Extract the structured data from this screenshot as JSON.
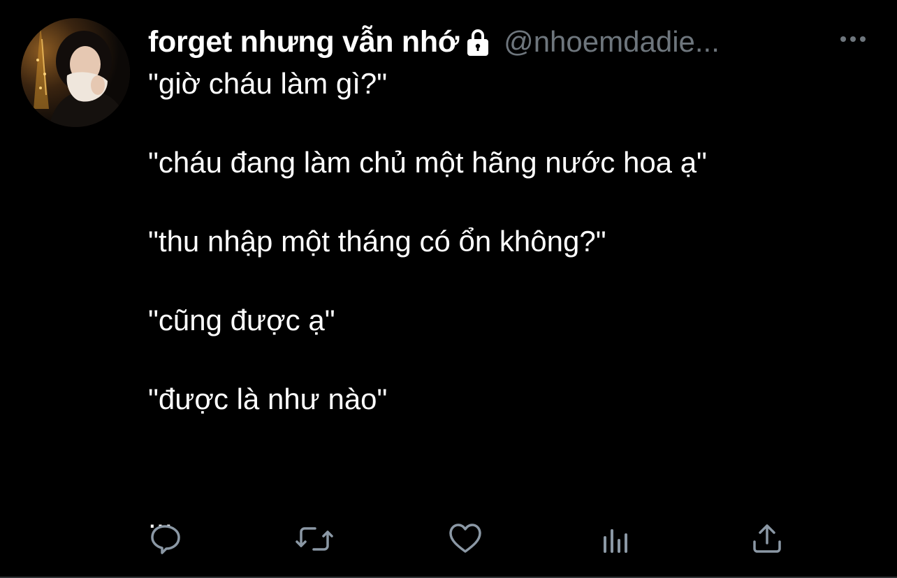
{
  "tweet": {
    "display_name": "forget nhưng vẫn nhớ",
    "handle": "@nhoemdadie...",
    "text": "\"giờ cháu làm gì?\"\n\n\"cháu đang làm chủ một hãng nước hoa ạ\"\n\n\"thu nhập một tháng có ổn không?\"\n\n\"cũng được ạ\"\n\n\"được là như nào\"\n\n\n...",
    "protected_icon": "lock-icon",
    "more_icon": "more-horizontal-icon"
  },
  "actions": [
    {
      "name": "reply",
      "icon": "speech-bubble-icon"
    },
    {
      "name": "retweet",
      "icon": "retweet-arrows-icon"
    },
    {
      "name": "like",
      "icon": "heart-icon"
    },
    {
      "name": "analytics",
      "icon": "bar-chart-icon"
    },
    {
      "name": "share",
      "icon": "share-upload-icon"
    }
  ],
  "colors": {
    "background": "#000000",
    "text": "#ffffff",
    "secondary": "#6e767d",
    "icon": "#8b98a5"
  }
}
